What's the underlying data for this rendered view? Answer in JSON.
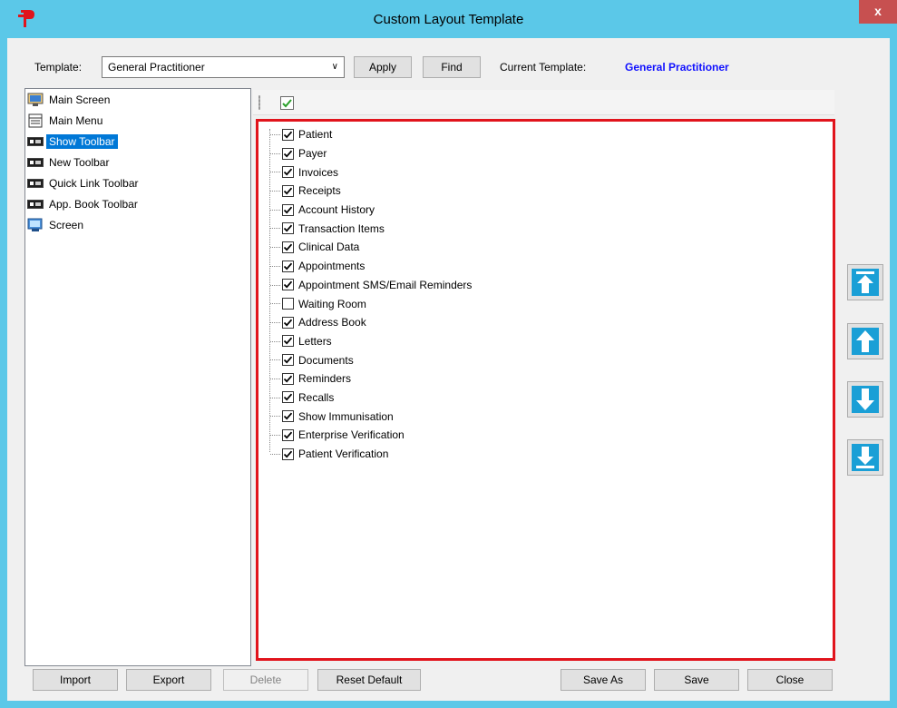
{
  "window": {
    "title": "Custom Layout Template",
    "close_label": "x"
  },
  "header": {
    "template_label": "Template:",
    "template_value": "General Practitioner",
    "apply_label": "Apply",
    "find_label": "Find",
    "current_label": "Current Template:",
    "current_value": "General Practitioner"
  },
  "sidebar": {
    "items": [
      {
        "label": "Main Screen",
        "icon": "main-screen-icon"
      },
      {
        "label": "Main Menu",
        "icon": "menu-icon"
      },
      {
        "label": "Show Toolbar",
        "icon": "toolbar-icon",
        "selected": true
      },
      {
        "label": "New Toolbar",
        "icon": "toolbar-icon"
      },
      {
        "label": "Quick Link Toolbar",
        "icon": "toolbar-icon"
      },
      {
        "label": "App. Book Toolbar",
        "icon": "toolbar-icon"
      },
      {
        "label": "Screen",
        "icon": "screen-icon"
      }
    ]
  },
  "tree": {
    "items": [
      {
        "label": "Patient",
        "checked": true
      },
      {
        "label": "Payer",
        "checked": true
      },
      {
        "label": "Invoices",
        "checked": true
      },
      {
        "label": "Receipts",
        "checked": true
      },
      {
        "label": "Account History",
        "checked": true
      },
      {
        "label": "Transaction Items",
        "checked": true
      },
      {
        "label": "Clinical Data",
        "checked": true
      },
      {
        "label": "Appointments",
        "checked": true
      },
      {
        "label": "Appointment SMS/Email Reminders",
        "checked": true
      },
      {
        "label": "Waiting Room",
        "checked": false
      },
      {
        "label": "Address Book",
        "checked": true
      },
      {
        "label": "Letters",
        "checked": true
      },
      {
        "label": "Documents",
        "checked": true
      },
      {
        "label": "Reminders",
        "checked": true
      },
      {
        "label": "Recalls",
        "checked": true
      },
      {
        "label": "Show Immunisation",
        "checked": true
      },
      {
        "label": "Enterprise Verification",
        "checked": true
      },
      {
        "label": "Patient Verification",
        "checked": true
      }
    ]
  },
  "footer": {
    "import_label": "Import",
    "export_label": "Export",
    "delete_label": "Delete",
    "reset_label": "Reset Default",
    "saveas_label": "Save As",
    "save_label": "Save",
    "close_label": "Close"
  },
  "colors": {
    "accent": "#5bc8e8",
    "highlight": "#e1141c",
    "selection": "#0078d7",
    "link": "#1010ff"
  }
}
